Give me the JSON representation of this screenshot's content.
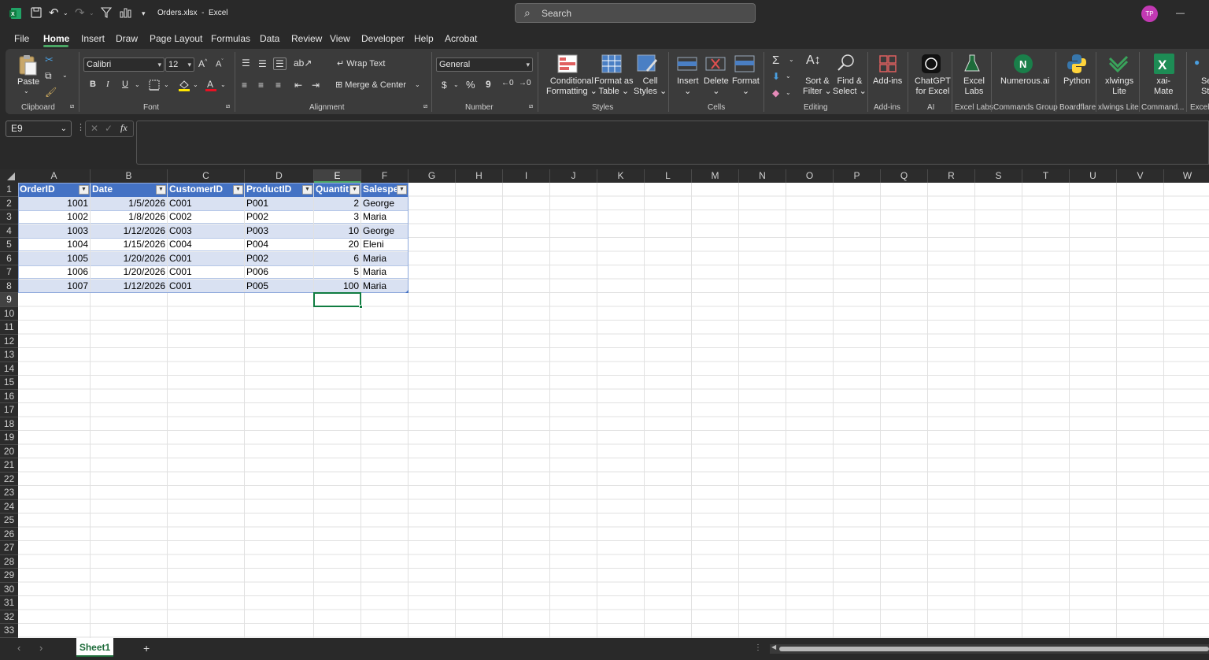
{
  "titlebar": {
    "filename": "Orders.xlsx",
    "separator": "-",
    "app_name": "Excel",
    "search_placeholder": "Search",
    "avatar_initials": "TP",
    "minimize_glyph": "—"
  },
  "menu": {
    "tabs": [
      "File",
      "Home",
      "Insert",
      "Draw",
      "Page Layout",
      "Formulas",
      "Data",
      "Review",
      "View",
      "Developer",
      "Help",
      "Acrobat"
    ],
    "active": "Home"
  },
  "ribbon": {
    "groups": {
      "clipboard": "Clipboard",
      "font": "Font",
      "alignment": "Alignment",
      "number": "Number",
      "styles": "Styles",
      "cells": "Cells",
      "editing": "Editing",
      "addins": "Add-ins",
      "ai": "AI",
      "excel_labs": "Excel Labs",
      "commands_group": "Commands Group",
      "boardflare": "Boardflare",
      "xlwings_lite": "xlwings Lite",
      "command_more": "Command...",
      "excel_more": "Excel"
    },
    "paste": "Paste",
    "font_name": "Calibri",
    "font_size": "12",
    "bold": "B",
    "italic": "I",
    "underline": "U",
    "wrap_text": "Wrap Text",
    "merge_center": "Merge & Center",
    "number_format": "General",
    "currency": "$",
    "percent": "%",
    "comma": "9",
    "conditional_formatting": [
      "Conditional",
      "Formatting"
    ],
    "format_as_table": [
      "Format as",
      "Table"
    ],
    "cell_styles": [
      "Cell",
      "Styles"
    ],
    "insert": "Insert",
    "delete": "Delete",
    "format": "Format",
    "sort_filter": [
      "Sort &",
      "Filter"
    ],
    "find_select": [
      "Find &",
      "Select"
    ],
    "addins_btn": "Add-ins",
    "chatgpt": [
      "ChatGPT",
      "for Excel"
    ],
    "excel_labs_btn": [
      "Excel",
      "Labs"
    ],
    "numerous": "Numerous.ai",
    "python": "Python",
    "xlwings": [
      "xlwings",
      "Lite"
    ],
    "xai_mate": [
      "xai-",
      "Mate"
    ],
    "cut_off": [
      "Se",
      "St"
    ]
  },
  "formula_bar": {
    "name_box": "E9",
    "fx": "fx",
    "formula": ""
  },
  "columns": [
    "A",
    "B",
    "C",
    "D",
    "E",
    "F",
    "G",
    "H",
    "I",
    "J",
    "K",
    "L",
    "M",
    "N",
    "O",
    "P",
    "Q",
    "R",
    "S",
    "T",
    "U",
    "V",
    "W"
  ],
  "rows": [
    "1",
    "2",
    "3",
    "4",
    "5",
    "6",
    "7",
    "8",
    "9",
    "10",
    "11",
    "12",
    "13",
    "14",
    "15",
    "16",
    "17",
    "18",
    "19",
    "20",
    "21",
    "22",
    "23",
    "24",
    "25",
    "26",
    "27",
    "28",
    "29",
    "30",
    "31",
    "32",
    "33"
  ],
  "table": {
    "headers": [
      "OrderID",
      "Date",
      "CustomerID",
      "ProductID",
      "Quantit",
      "Salespe"
    ],
    "rows": [
      [
        "1001",
        "1/5/2026",
        "C001",
        "P001",
        "2",
        "George"
      ],
      [
        "1002",
        "1/8/2026",
        "C002",
        "P002",
        "3",
        "Maria"
      ],
      [
        "1003",
        "1/12/2026",
        "C003",
        "P003",
        "10",
        "George"
      ],
      [
        "1004",
        "1/15/2026",
        "C004",
        "P004",
        "20",
        "Eleni"
      ],
      [
        "1005",
        "1/20/2026",
        "C001",
        "P002",
        "6",
        "Maria"
      ],
      [
        "1006",
        "1/20/2026",
        "C001",
        "P006",
        "5",
        "Maria"
      ],
      [
        "1007",
        "1/12/2026",
        "C001",
        "P005",
        "100",
        "Maria"
      ]
    ]
  },
  "selected_cell": "E9",
  "sheets": {
    "tabs": [
      "Sheet1"
    ],
    "add": "+"
  },
  "colors": {
    "table_header": "#4472c4",
    "band": "#d9e1f2",
    "accent": "#4aa564"
  }
}
